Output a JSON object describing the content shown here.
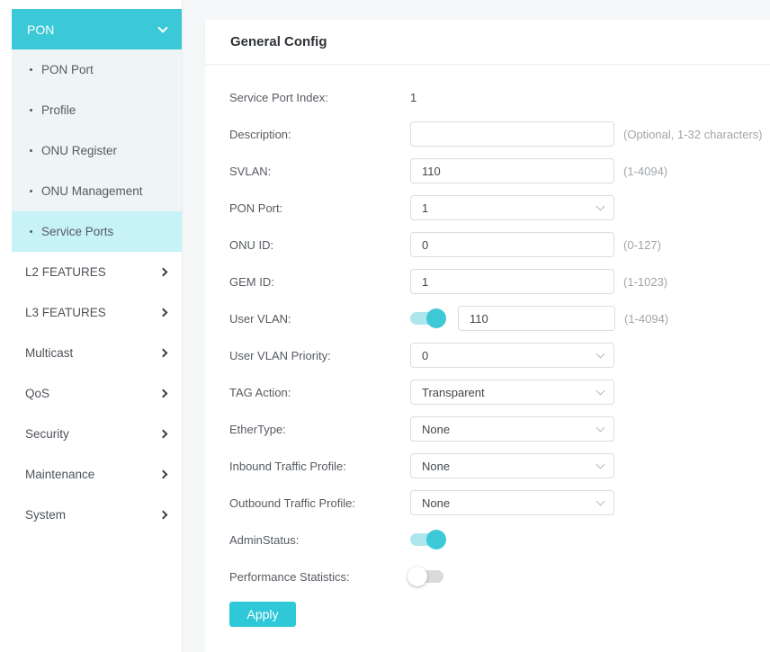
{
  "colors": {
    "accent": "#3bc9d7",
    "accent_button": "#2fc8d8",
    "active_item_bg": "#c7f2f6",
    "submenu_bg": "#eff4f7",
    "toggle_on_track": "#ade6ec",
    "toggle_on_knob": "#3ec9d7",
    "toggle_off_track": "#d8dadc"
  },
  "sidebar": {
    "pon": {
      "label": "PON",
      "expanded": true,
      "items": [
        {
          "label": "PON Port",
          "active": false
        },
        {
          "label": "Profile",
          "active": false
        },
        {
          "label": "ONU Register",
          "active": false
        },
        {
          "label": "ONU Management",
          "active": false
        },
        {
          "label": "Service Ports",
          "active": true
        }
      ]
    },
    "sections": [
      {
        "label": "L2 FEATURES"
      },
      {
        "label": "L3 FEATURES"
      },
      {
        "label": "Multicast"
      },
      {
        "label": "QoS"
      },
      {
        "label": "Security"
      },
      {
        "label": "Maintenance"
      },
      {
        "label": "System"
      }
    ]
  },
  "main": {
    "title": "General Config",
    "form": {
      "service_port_index": {
        "label": "Service Port Index:",
        "value": "1"
      },
      "description": {
        "label": "Description:",
        "value": "",
        "hint": "(Optional, 1-32 characters)"
      },
      "svlan": {
        "label": "SVLAN:",
        "value": "110",
        "hint": "(1-4094)"
      },
      "pon_port": {
        "label": "PON Port:",
        "value": "1"
      },
      "onu_id": {
        "label": "ONU ID:",
        "value": "0",
        "hint": "(0-127)"
      },
      "gem_id": {
        "label": "GEM ID:",
        "value": "1",
        "hint": "(1-1023)"
      },
      "user_vlan": {
        "label": "User VLAN:",
        "enabled": true,
        "value": "110",
        "hint": "(1-4094)"
      },
      "user_vlan_priority": {
        "label": "User VLAN Priority:",
        "value": "0"
      },
      "tag_action": {
        "label": "TAG Action:",
        "value": "Transparent"
      },
      "ethertype": {
        "label": "EtherType:",
        "value": "None"
      },
      "inbound_traffic_profile": {
        "label": "Inbound Traffic Profile:",
        "value": "None"
      },
      "outbound_traffic_profile": {
        "label": "Outbound Traffic Profile:",
        "value": "None"
      },
      "admin_status": {
        "label": "AdminStatus:",
        "enabled": true
      },
      "performance_statistics": {
        "label": "Performance Statistics:",
        "enabled": false
      },
      "apply_label": "Apply"
    }
  }
}
